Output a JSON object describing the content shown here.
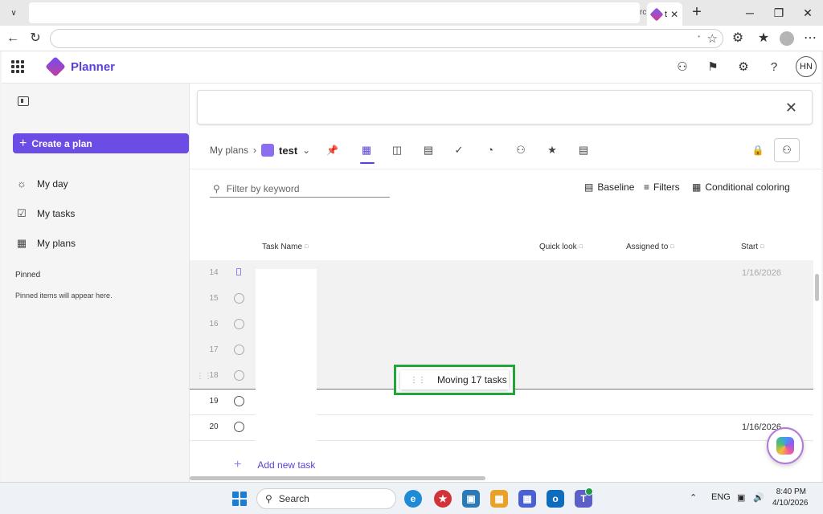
{
  "browser": {
    "tab_title_prev": "rc",
    "tab_title": "t",
    "tab_close": "✕",
    "new_tab": "+",
    "minimize": "─",
    "restore": "❐",
    "close": "✕"
  },
  "app": {
    "name": "Planner",
    "user_initials": "HN"
  },
  "sidebar": {
    "create_label": "Create a plan",
    "items": [
      {
        "label": "My day",
        "icon": "sun-icon"
      },
      {
        "label": "My tasks",
        "icon": "tasks-icon"
      },
      {
        "label": "My plans",
        "icon": "grid-icon"
      }
    ],
    "pinned_heading": "Pinned",
    "pinned_text": "Pinned items will appear here."
  },
  "toolbar": {
    "breadcrumb_root": "My plans",
    "plan_name": "test",
    "filter_placeholder": "Filter by keyword",
    "baseline": "Baseline",
    "filters": "Filters",
    "conditional": "Conditional coloring"
  },
  "columns": {
    "task_name": "Task Name",
    "quick_look": "Quick look",
    "assigned_to": "Assigned to",
    "start": "Start"
  },
  "rows": [
    {
      "num": "14",
      "date": "1/16/2026"
    },
    {
      "num": "15",
      "date": ""
    },
    {
      "num": "16",
      "date": ""
    },
    {
      "num": "17",
      "date": ""
    },
    {
      "num": "18",
      "date": ""
    },
    {
      "num": "19",
      "date": ""
    },
    {
      "num": "20",
      "date": "1/16/2026"
    }
  ],
  "drag_text": "Moving 17 tasks",
  "add_task": "Add new task",
  "taskbar": {
    "search": "Search",
    "lang": "ENG",
    "time": "8:40 PM",
    "date": "4/10/2026"
  }
}
